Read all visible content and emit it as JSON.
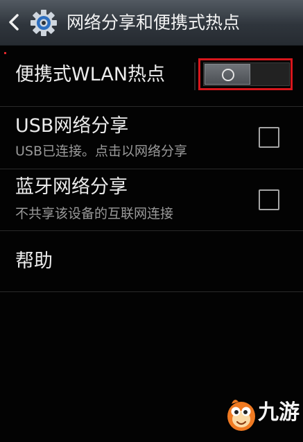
{
  "header": {
    "title": "网络分享和便携式热点",
    "back_icon": "chevron-left-icon",
    "app_icon": "gear-icon"
  },
  "hotspot": {
    "label": "便携式WLAN热点",
    "toggle_on": false,
    "highlight_color": "#d8161c"
  },
  "usb_tethering": {
    "label": "USB网络分享",
    "summary": "USB已连接。点击以网络分享",
    "checked": false
  },
  "bluetooth_tethering": {
    "label": "蓝牙网络分享",
    "summary": "不共享该设备的互联网连接",
    "checked": false
  },
  "help": {
    "label": "帮助"
  },
  "watermark": {
    "text": "九游"
  }
}
